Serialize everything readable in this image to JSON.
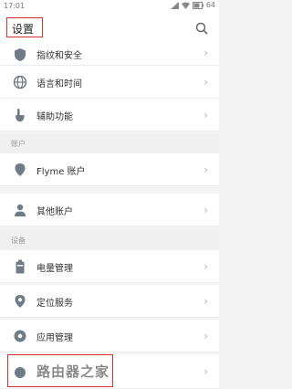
{
  "status_bar": {
    "time": "17:01",
    "battery": "64"
  },
  "header": {
    "title": "设置",
    "search_icon": "search-icon"
  },
  "items": [
    {
      "label": "指纹和安全",
      "icon": "shield-icon"
    },
    {
      "label": "语言和时间",
      "icon": "globe-icon"
    },
    {
      "label": "辅助功能",
      "icon": "hand-icon"
    },
    {
      "label": "Flyme 账户",
      "icon": "location-pin-icon"
    },
    {
      "label": "其他账户",
      "icon": "person-icon"
    },
    {
      "label": "电量管理",
      "icon": "battery-icon"
    },
    {
      "label": "定位服务",
      "icon": "location-icon"
    },
    {
      "label": "应用管理",
      "icon": "apps-icon"
    }
  ],
  "sections": {
    "accounts": "账户",
    "device": "设备"
  },
  "watermark": "路由器之家",
  "colors": {
    "highlight_border": "#d63030",
    "icon": "#6f7b86"
  }
}
